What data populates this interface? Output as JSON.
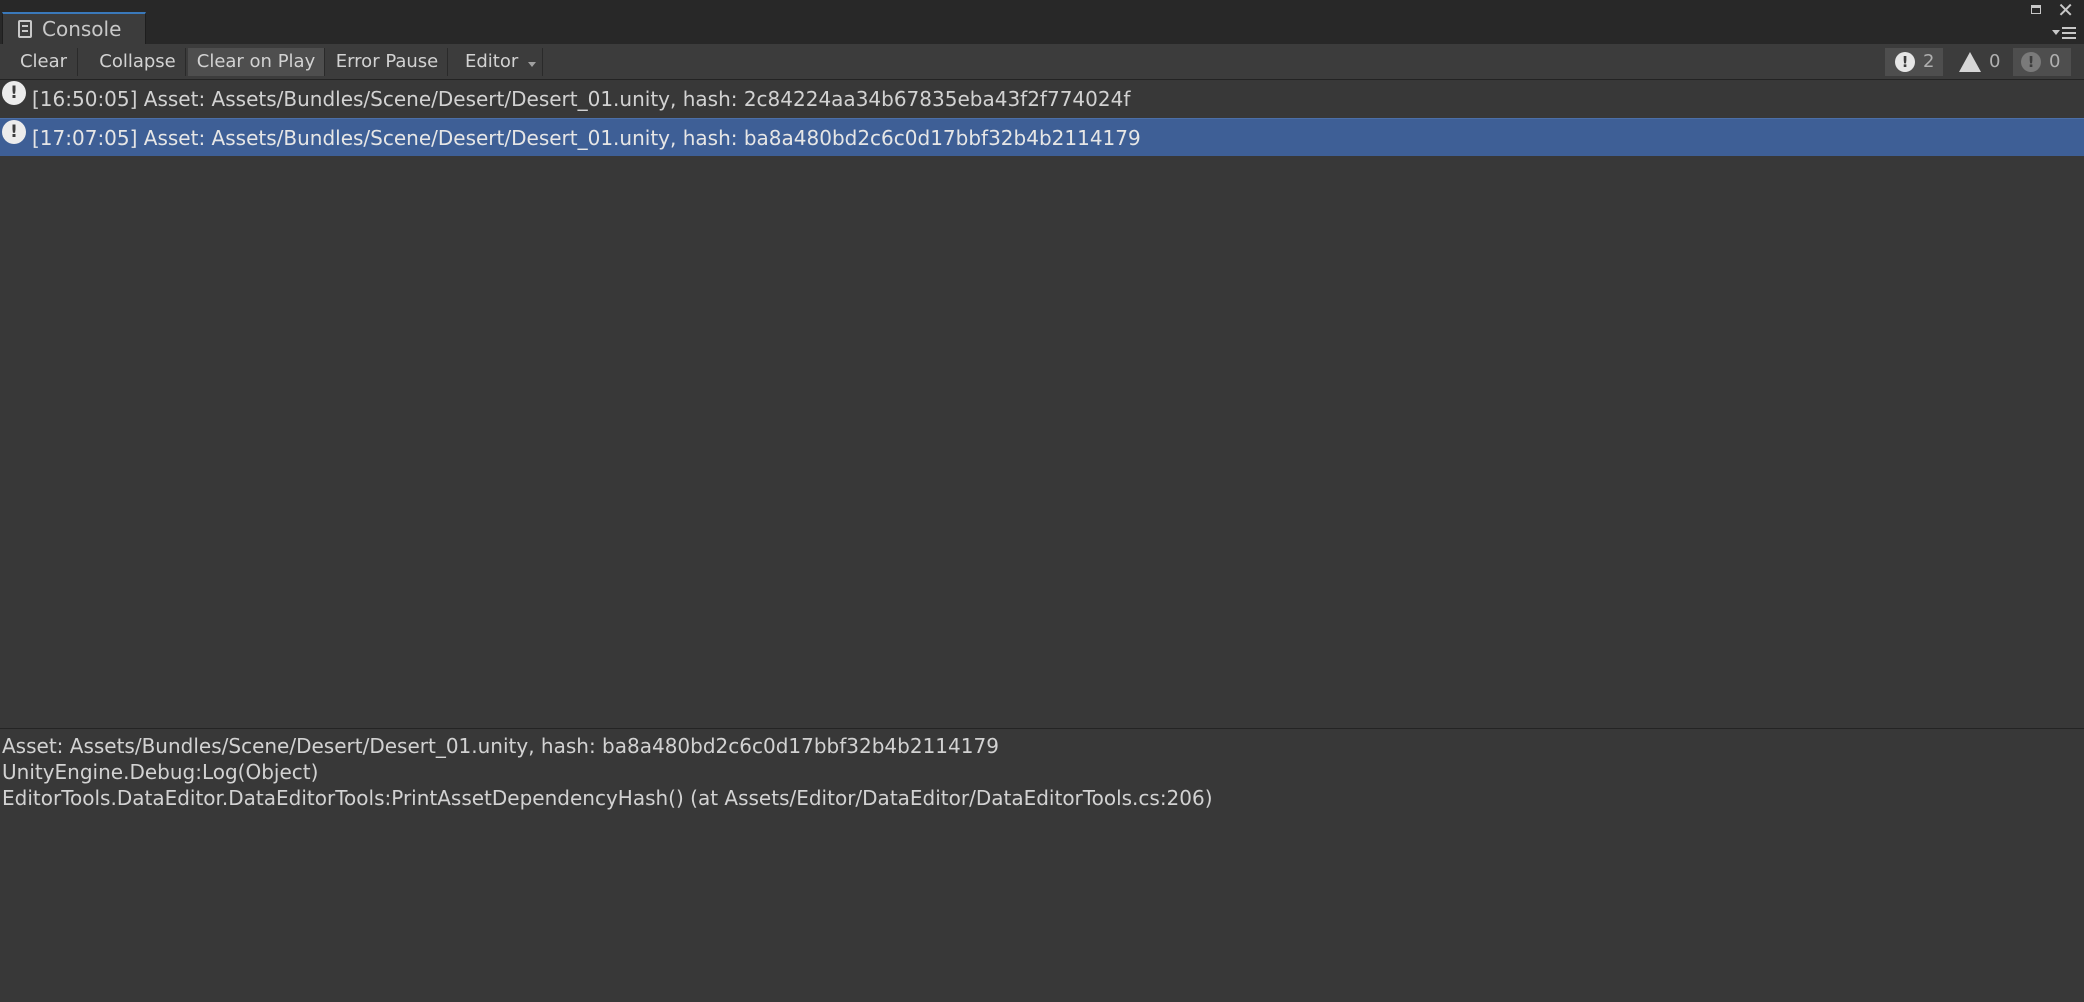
{
  "window": {
    "tab_title": "Console"
  },
  "toolbar": {
    "clear_label": "Clear",
    "collapse_label": "Collapse",
    "clear_on_play_label": "Clear on Play",
    "error_pause_label": "Error Pause",
    "editor_label": "Editor"
  },
  "counters": {
    "log_count": "2",
    "warning_count": "0",
    "error_count": "0"
  },
  "log_entries": [
    {
      "text": "[16:50:05] Asset: Assets/Bundles/Scene/Desert/Desert_01.unity, hash: 2c84224aa34b67835eba43f2f774024f",
      "selected": false
    },
    {
      "text": "[17:07:05] Asset: Assets/Bundles/Scene/Desert/Desert_01.unity, hash: ba8a480bd2c6c0d17bbf32b4b2114179",
      "selected": true
    }
  ],
  "detail": {
    "lines": [
      "Asset: Assets/Bundles/Scene/Desert/Desert_01.unity, hash: ba8a480bd2c6c0d17bbf32b4b2114179",
      "UnityEngine.Debug:Log(Object)",
      "EditorTools.DataEditor.DataEditorTools:PrintAssetDependencyHash() (at Assets/Editor/DataEditor/DataEditorTools.cs:206)"
    ]
  },
  "colors": {
    "background": "#383838",
    "toolbar": "#3c3c3c",
    "selection": "#3e5f96",
    "tab_accent": "#3a79bb"
  }
}
